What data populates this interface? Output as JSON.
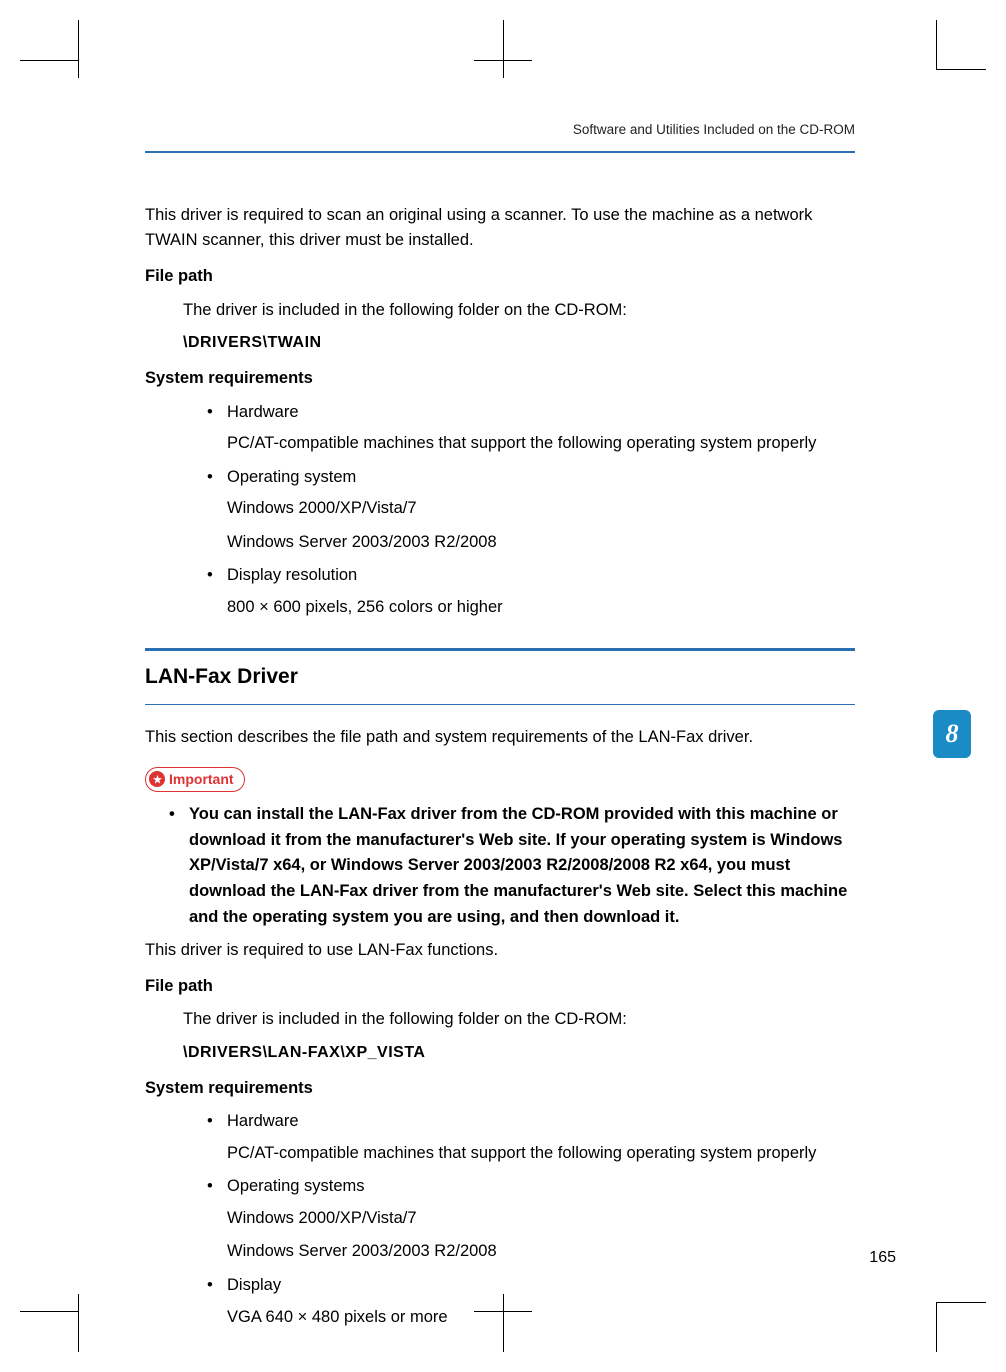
{
  "runningHead": "Software and Utilities Included on the CD-ROM",
  "introTwain": "This driver is required to scan an original using a scanner. To use the machine as a network TWAIN scanner, this driver must be installed.",
  "labels": {
    "filePath": "File path",
    "sysReq": "System requirements",
    "important": "Important"
  },
  "twain": {
    "filePathText": "The driver is included in the following folder on the CD-ROM:",
    "filePathValue": "\\DRIVERS\\TWAIN",
    "req": {
      "hardwareLabel": "Hardware",
      "hardwareText": "PC/AT-compatible machines that support the following operating system properly",
      "osLabel": "Operating system",
      "osLine1": "Windows 2000/XP/Vista/7",
      "osLine2": "Windows Server 2003/2003 R2/2008",
      "dispLabel": "Display resolution",
      "dispText": "800 × 600 pixels, 256 colors or higher"
    }
  },
  "lanfax": {
    "title": "LAN-Fax Driver",
    "intro": "This section describes the file path and system requirements of the LAN-Fax driver.",
    "importantBullet": "You can install the LAN-Fax driver from the CD-ROM provided with this machine or download it from the manufacturer's Web site. If your operating system is Windows XP/Vista/7 x64, or Windows Server 2003/2003 R2/2008/2008 R2 x64, you must download the LAN-Fax driver from the manufacturer's Web site. Select this machine and the operating system you are using, and then download it.",
    "requiredText": "This driver is required to use LAN-Fax functions.",
    "filePathText": "The driver is included in the following folder on the CD-ROM:",
    "filePathValue": "\\DRIVERS\\LAN-FAX\\XP_VISTA",
    "req": {
      "hardwareLabel": "Hardware",
      "hardwareText": "PC/AT-compatible machines that support the following operating system properly",
      "osLabel": "Operating systems",
      "osLine1": "Windows 2000/XP/Vista/7",
      "osLine2": "Windows Server 2003/2003 R2/2008",
      "dispLabel": "Display",
      "dispText": "VGA 640 × 480 pixels or more"
    }
  },
  "chapterNumber": "8",
  "pageNumber": "165"
}
